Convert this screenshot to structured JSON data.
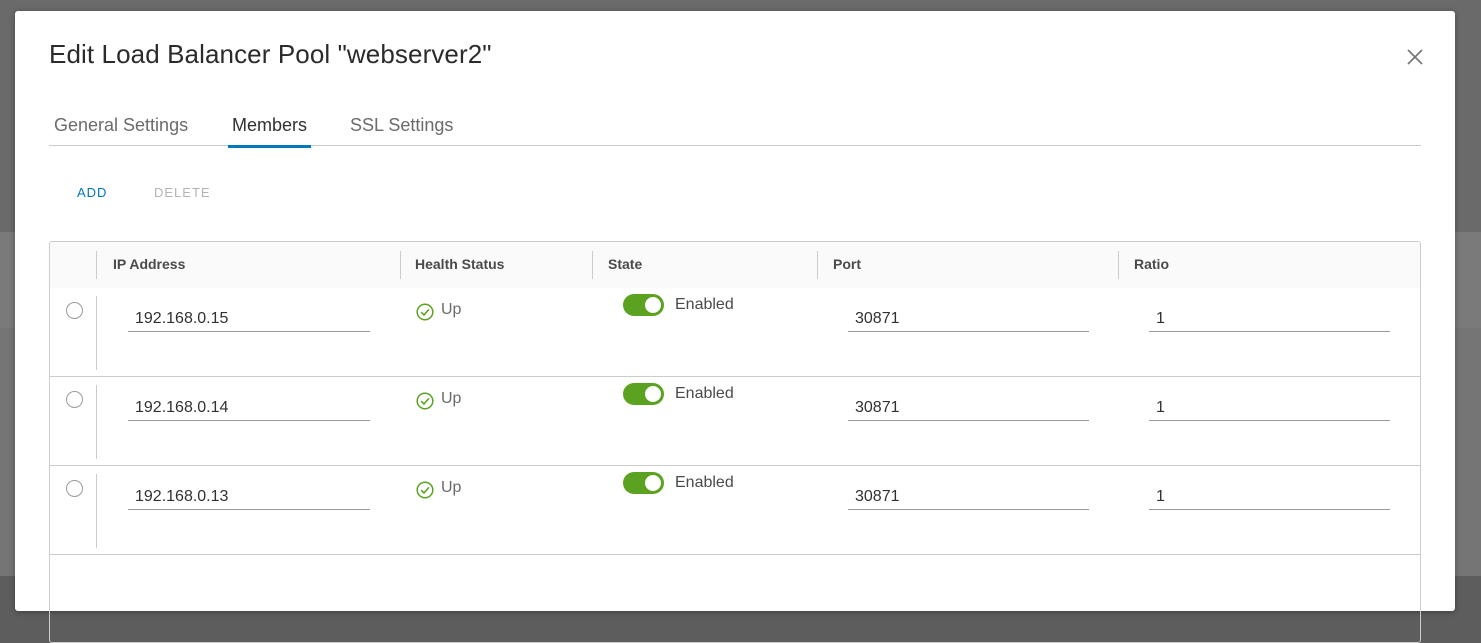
{
  "dialog": {
    "title": "Edit Load Balancer Pool \"webserver2\""
  },
  "tabs": [
    {
      "label": "General Settings"
    },
    {
      "label": "Members"
    },
    {
      "label": "SSL Settings"
    }
  ],
  "actions": {
    "add_label": "ADD",
    "delete_label": "DELETE"
  },
  "table": {
    "columns": [
      "IP Address",
      "Health Status",
      "State",
      "Port",
      "Ratio"
    ],
    "rows": [
      {
        "ip": "192.168.0.15",
        "health": "Up",
        "state": "Enabled",
        "port": "30871",
        "ratio": "1"
      },
      {
        "ip": "192.168.0.14",
        "health": "Up",
        "state": "Enabled",
        "port": "30871",
        "ratio": "1"
      },
      {
        "ip": "192.168.0.13",
        "health": "Up",
        "state": "Enabled",
        "port": "30871",
        "ratio": "1"
      }
    ]
  },
  "colors": {
    "accent": "#0079b8",
    "toggle_on": "#5aa220",
    "health_ok": "#5aa220",
    "disabled_text": "#b3b3b3"
  },
  "icons": {
    "close": "close-icon",
    "health": "check-circle-icon"
  }
}
